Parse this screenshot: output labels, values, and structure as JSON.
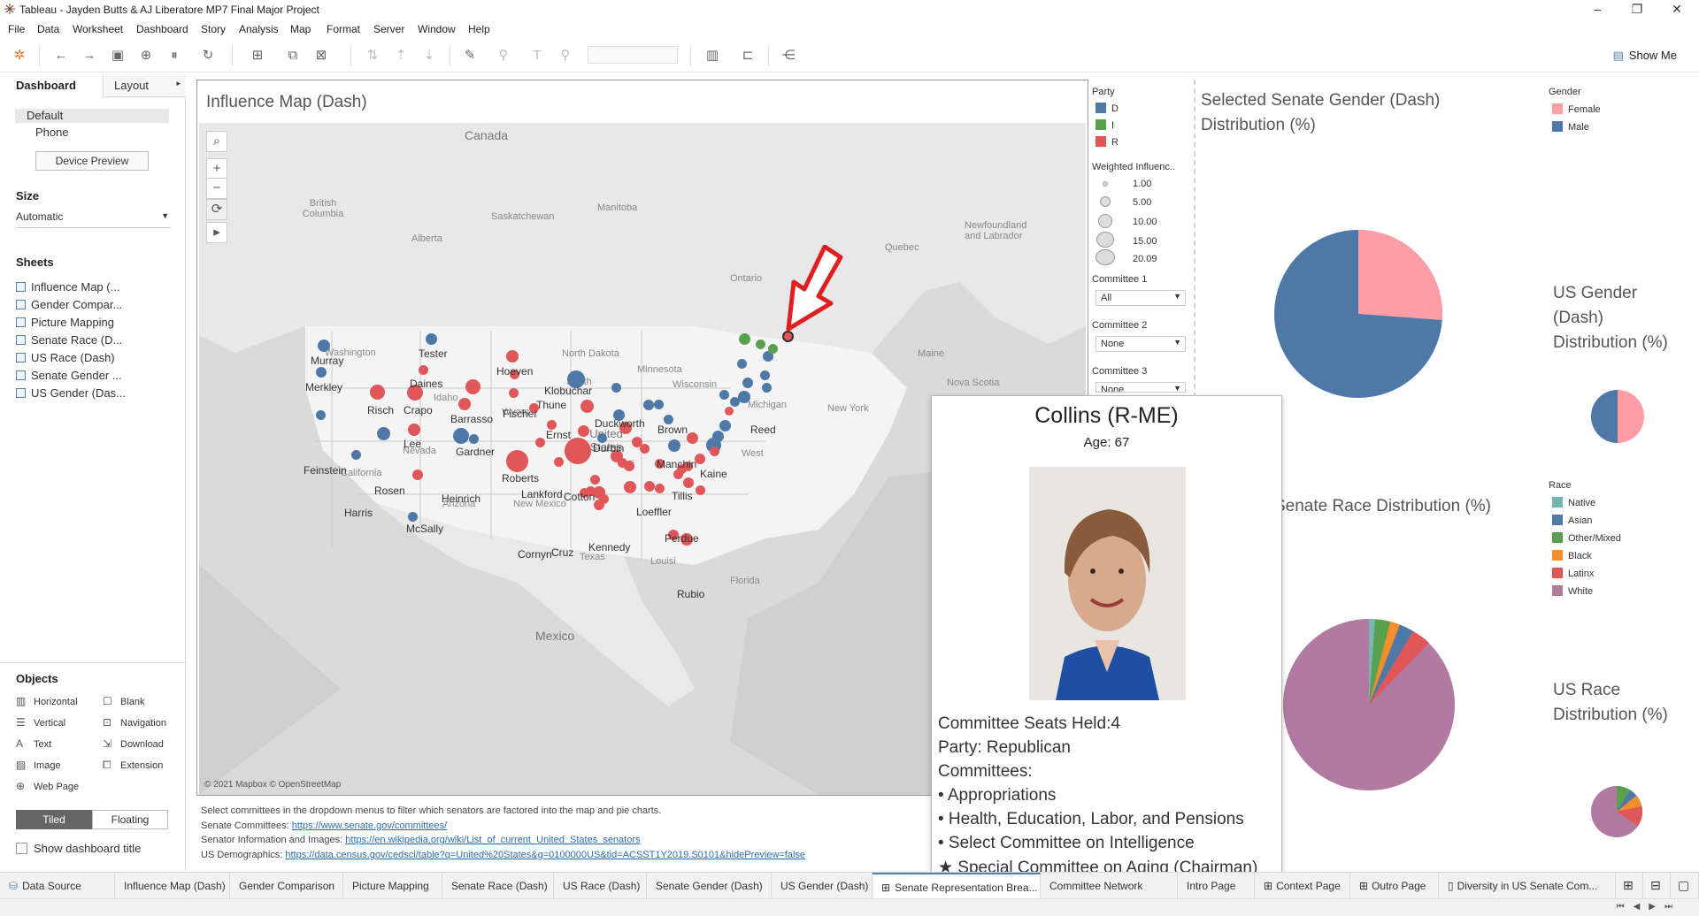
{
  "window": {
    "title": "Tableau - Jayden Butts & AJ Liberatore MP7 Final Major Project"
  },
  "menu": [
    "File",
    "Data",
    "Worksheet",
    "Dashboard",
    "Story",
    "Analysis",
    "Map",
    "Format",
    "Server",
    "Window",
    "Help"
  ],
  "toolbar": {
    "show_me": "Show Me"
  },
  "left_panel": {
    "tab_dashboard": "Dashboard",
    "tab_layout": "Layout",
    "device_default": "Default",
    "device_phone": "Phone",
    "device_preview": "Device Preview",
    "size_heading": "Size",
    "size_value": "Automatic",
    "sheets_heading": "Sheets",
    "sheets": [
      "Influence Map (...",
      "Gender Compar...",
      "Picture Mapping",
      "Senate Race (D...",
      "US Race (Dash)",
      "Senate Gender ...",
      "US Gender (Das..."
    ],
    "objects_heading": "Objects",
    "objects": [
      "Horizontal",
      "Blank",
      "Vertical",
      "Navigation",
      "Text",
      "Download",
      "Image",
      "Extension",
      "Web Page"
    ],
    "tiled": "Tiled",
    "floating": "Floating",
    "show_title": "Show dashboard title"
  },
  "map": {
    "title": "Influence Map (Dash)",
    "copyright": "© 2021 Mapbox © OpenStreetMap",
    "geo_labels": [
      "Canada",
      "British Columbia",
      "Alberta",
      "Saskatchewan",
      "Manitoba",
      "Ontario",
      "Quebec",
      "Newfoundland and Labrador",
      "North Dakota",
      "South",
      "Minnesota",
      "Wisconsin",
      "Michigan",
      "New York",
      "Maine",
      "Nova Scotia",
      "United States",
      "Nevada",
      "California",
      "Arizona",
      "New Mexico",
      "Texas",
      "Louisi",
      "Florida",
      "Mexico",
      "West",
      "Wyom",
      "Idaho",
      "Washington",
      "Mi"
    ],
    "senators": [
      "Murray",
      "Merkley",
      "Tester",
      "Daines",
      "Risch",
      "Crapo",
      "Barrasso",
      "Hoeven",
      "Thune",
      "Fischer",
      "Klobuchar",
      "Ernst",
      "Duckworth",
      "Brown",
      "Reed",
      "Lee",
      "Gardner",
      "Durbin",
      "Feinstein",
      "Roberts",
      "Manchin",
      "Kaine",
      "Rosen",
      "Lankford",
      "Cotton",
      "Tillis",
      "Heinrich",
      "Harris",
      "Loeffler",
      "McSally",
      "Perdue",
      "Kennedy",
      "Cornyn",
      "Cruz",
      "Rubio"
    ]
  },
  "footnotes": {
    "line1": "Select committees in the dropdown menus to filter which senators are factored into the map and pie charts.",
    "line2_label": "Senate Committees: ",
    "line2_link": "https://www.senate.gov/committees/",
    "line3_label": "Senator Information and Images: ",
    "line3_link": "https://en.wikipedia.org/wiki/List_of_current_United_States_senators",
    "line4_label": "US Demographics: ",
    "line4_link": "https://data.census.gov/cedsci/table?q=United%20States&g=0100000US&tid=ACSST1Y2019.S0101&hidePreview=false"
  },
  "legends": {
    "party_heading": "Party",
    "party_items": [
      {
        "label": "D",
        "color": "#4e79a7"
      },
      {
        "label": "I",
        "color": "#59a14f"
      },
      {
        "label": "R",
        "color": "#e15759"
      }
    ],
    "weighted_heading": "Weighted Influenc..",
    "weighted_items": [
      "1.00",
      "5.00",
      "10.00",
      "15.00",
      "20.09"
    ],
    "committee1_heading": "Committee 1",
    "committee1_value": "All",
    "committee2_heading": "Committee 2",
    "committee2_value": "None",
    "committee3_heading": "Committee 3",
    "committee3_value": "None"
  },
  "right": {
    "selected_gender_title": "Selected Senate Gender (Dash) Distribution (%)",
    "gender_legend_heading": "Gender",
    "gender_items": [
      {
        "label": "Female",
        "color": "#ff9da7"
      },
      {
        "label": "Male",
        "color": "#4e79a7"
      }
    ],
    "us_gender_title": "US Gender (Dash) Distribution (%)",
    "senate_race_title": "Senate Race Distribution (%)",
    "race_legend_heading": "Race",
    "race_items": [
      {
        "label": "Native",
        "color": "#76b7b2"
      },
      {
        "label": "Asian",
        "color": "#4e79a7"
      },
      {
        "label": "Other/Mixed",
        "color": "#59a14f"
      },
      {
        "label": "Black",
        "color": "#f28e2b"
      },
      {
        "label": "Latinx",
        "color": "#e15759"
      },
      {
        "label": "White",
        "color": "#b07aa1"
      }
    ],
    "us_race_title": "US Race Distribution (%)"
  },
  "tooltip": {
    "name": "Collins (R-ME)",
    "age": "Age: 67",
    "seats": "Committee Seats Held:4",
    "party": "Party: Republican",
    "committees_heading": "Committees:",
    "committees": [
      "• Appropriations",
      "• Health, Education, Labor, and Pensions",
      "• Select Committee on Intelligence",
      "★ Special Committee on Aging (Chairman)"
    ]
  },
  "bottom_tabs": [
    "Data Source",
    "Influence Map (Dash)",
    "Gender Comparison",
    "Picture Mapping",
    "Senate Race (Dash)",
    "US Race (Dash)",
    "Senate Gender (Dash)",
    "US Gender (Dash)",
    "Senate Representation Brea...",
    "Committee Network",
    "Intro Page",
    "Context Page",
    "Outro Page",
    "Diversity in US Senate Com..."
  ]
}
